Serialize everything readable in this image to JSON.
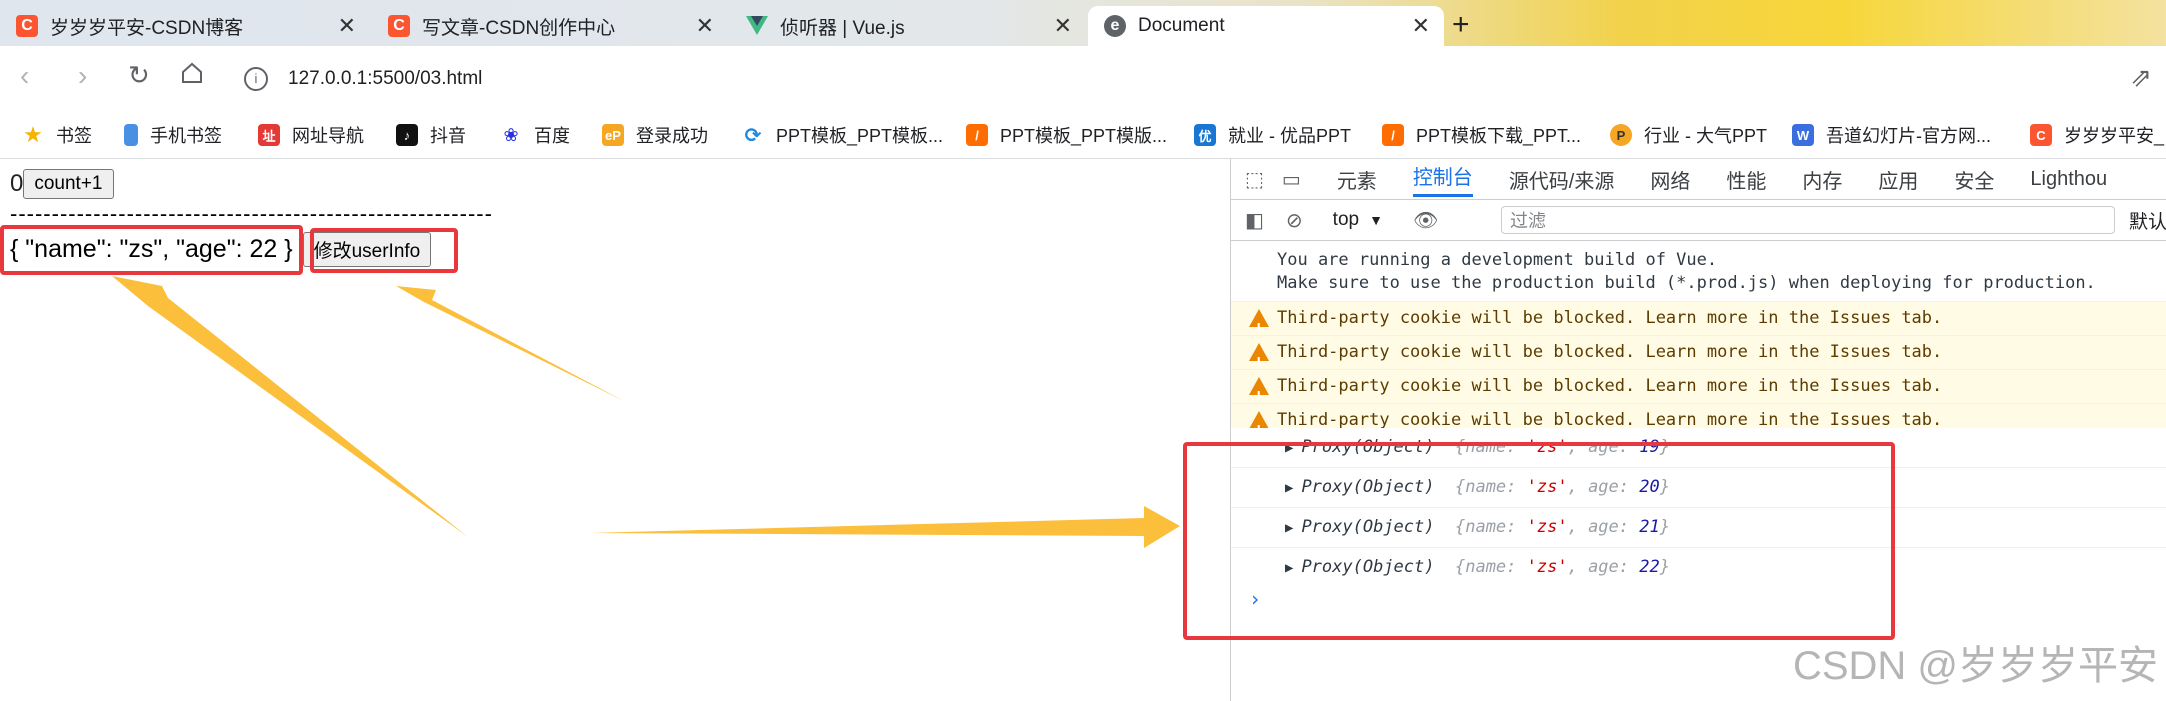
{
  "tabs": [
    {
      "title": "岁岁岁平安-CSDN博客",
      "favicon": "csdn-icon",
      "active": false
    },
    {
      "title": "写文章-CSDN创作中心",
      "favicon": "csdn-icon",
      "active": false
    },
    {
      "title": "侦听器 | Vue.js",
      "favicon": "vue-icon",
      "active": false
    },
    {
      "title": "Document",
      "favicon": "page-icon",
      "active": true
    }
  ],
  "tab_close_glyph": "✕",
  "new_tab_glyph": "+",
  "address": {
    "url": "127.0.0.1:5500/03.html"
  },
  "bookmarks": [
    "书签",
    "手机书签",
    "网址导航",
    "抖音",
    "百度",
    "登录成功",
    "PPT模板_PPT模板...",
    "PPT模板_PPT模版...",
    "就业 - 优品PPT",
    "PPT模板下载_PPT...",
    "行业 - 大气PPT",
    "吾道幻灯片-官方网...",
    "岁岁岁平安_"
  ],
  "page": {
    "count_value": "0",
    "count_button": "count+1",
    "separator": "----------------------------------------------------------",
    "user_info": "{ \"name\": \"zs\", \"age\": 22 }",
    "modify_button": "修改userInfo"
  },
  "devtools": {
    "tabs": [
      "元素",
      "控制台",
      "源代码/来源",
      "网络",
      "性能",
      "内存",
      "应用",
      "安全",
      "Lighthou"
    ],
    "active_tab": "控制台",
    "context": "top",
    "filter_placeholder": "过滤",
    "levels_label": "默认",
    "console": {
      "info_line1": "You are running a development build of Vue.",
      "info_line2": "Make sure to use the production build (*.prod.js) when deploying for production.",
      "warnings": [
        "Third-party cookie will be blocked. Learn more in the Issues tab.",
        "Third-party cookie will be blocked. Learn more in the Issues tab.",
        "Third-party cookie will be blocked. Learn more in the Issues tab.",
        "Third-party cookie will be blocked. Learn more in the Issues tab."
      ],
      "logs": [
        {
          "label": "Proxy(Object)",
          "name": "'zs'",
          "age": "19"
        },
        {
          "label": "Proxy(Object)",
          "name": "'zs'",
          "age": "20"
        },
        {
          "label": "Proxy(Object)",
          "name": "'zs'",
          "age": "21"
        },
        {
          "label": "Proxy(Object)",
          "name": "'zs'",
          "age": "22"
        }
      ],
      "prompt": "›"
    }
  },
  "watermark": "CSDN @岁岁岁平安",
  "colors": {
    "annotation_red": "#e8383d",
    "arrow_yellow": "#fbbf3c",
    "accent_blue": "#1a73e8"
  }
}
